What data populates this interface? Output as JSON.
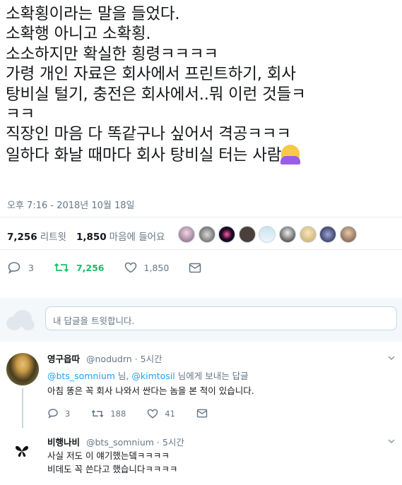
{
  "tweet": {
    "lines": [
      "소확횡이라는 말을 들었다.",
      "소확행 아니고 소확횡.",
      "소소하지만 확실한 횡령ㅋㅋㅋㅋ",
      "가령 개인 자료은 회사에서 프린트하기, 회사",
      "탕비실 털기, 충전은 회사에서..뭐 이런 것들ㅋ",
      "ㅋㅋ",
      "직장인 마음 다 똑같구나 싶어서 격공ㅋㅋㅋ",
      "일하다 화날 때마다 회사 탕비실 터는 사람"
    ],
    "emoji_icon": "person-raising-hand-emoji",
    "timestamp": "오후 7:16 - 2018년 10월 18일"
  },
  "stats": {
    "retweets_count": "7,256",
    "retweets_label": "리트윗",
    "likes_count": "1,850",
    "likes_label": "마음에 들어요"
  },
  "actions": {
    "reply_count": "3",
    "retweet_count": "7,256",
    "like_count": "1,850"
  },
  "compose": {
    "placeholder": "내 답글을 트윗합니다."
  },
  "replies": [
    {
      "name": "영구읍따",
      "handle": "@nodudrn",
      "time": "· 5시간",
      "to_mention_1": "@bts_somnium",
      "to_sep": " 님, ",
      "to_mention_2": "@kimtosil",
      "to_suffix": " 님에게 보내는 답글",
      "text": "아침 똥은 꼭 회사 나와서 싼다는 놈을 본 적이 있습니다.",
      "reply_count": "3",
      "retweet_count": "188",
      "like_count": "41"
    },
    {
      "name": "비행나비",
      "handle": "@bts_somnium",
      "time": "· 5시간",
      "text_1": "사실 저도 이 얘기했는뎈ㅋㅋㅋㅋ",
      "text_2": "비데도 꼭 쓴다고 했습니다ㅋㅋㅋㅋ"
    }
  ],
  "colors": {
    "text": "#14171a",
    "muted": "#657786",
    "link": "#1da1f2",
    "retweet_green": "#17bf63",
    "divider": "#e6ecf0"
  }
}
